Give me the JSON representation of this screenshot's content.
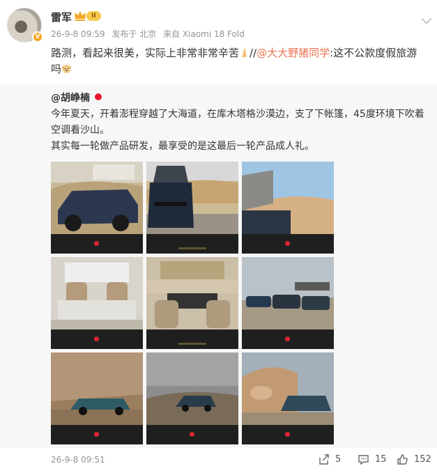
{
  "post": {
    "username": "雷军",
    "level": "II",
    "time": "26-9-8 09:59",
    "location": "发布于 北京",
    "device": "来自 Xiaomi 18 Fold",
    "text_before": "路测，看起来很美，实际上非常非常辛苦",
    "text_sep": "//",
    "mention": "@大大野猪同学",
    "text_after": ":这不公款度假旅游吗"
  },
  "repost": {
    "username": "@胡峥楠",
    "text_line1": "今年夏天，开着澎程穿越了大海道，在库木塔格沙漠边，支了下帐篷，45度环境下吹着空调看沙山。",
    "text_line2": "其实每一轮做产品研发，最享受的是这最后一轮产品成人礼。",
    "images": [
      {
        "name": "photo-suv-tent-desert"
      },
      {
        "name": "photo-suv-rear-tent"
      },
      {
        "name": "photo-tent-window-dunes"
      },
      {
        "name": "photo-interior-table"
      },
      {
        "name": "photo-tent-view-front-seats"
      },
      {
        "name": "photo-three-suvs-landmark"
      },
      {
        "name": "photo-suv-cliff"
      },
      {
        "name": "photo-suv-cloudy-desert"
      },
      {
        "name": "photo-suv-rock-sign"
      }
    ]
  },
  "footer": {
    "time": "26-9-8 09:51",
    "shares": "5",
    "comments": "15",
    "likes": "152"
  },
  "colors": {
    "mention": "#eb7350",
    "repost_bg": "#f7f7f7",
    "meta": "#939393",
    "vip_badge": "#f7c84a"
  }
}
